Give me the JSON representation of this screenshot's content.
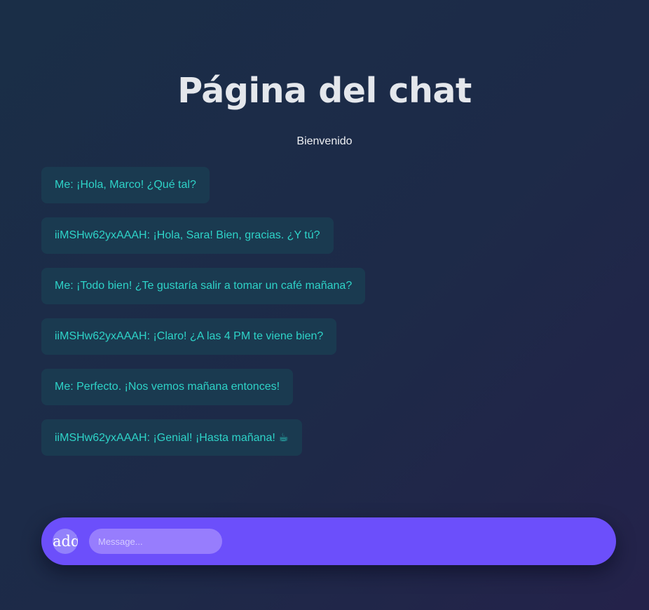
{
  "header": {
    "title": "Página del chat",
    "subtitle": "Bienvenido"
  },
  "messages": [
    {
      "text": "Me: ¡Hola, Marco! ¿Qué tal?"
    },
    {
      "text": "iiMSHw62yxAAAH: ¡Hola, Sara! Bien, gracias. ¿Y tú?"
    },
    {
      "text": "Me: ¡Todo bien! ¿Te gustaría salir a tomar un café mañana?"
    },
    {
      "text": "iiMSHw62yxAAAH: ¡Claro! ¿A las 4 PM te viene bien?"
    },
    {
      "text": "Me: Perfecto. ¡Nos vemos mañana entonces!"
    },
    {
      "text": "iiMSHw62yxAAAH: ¡Genial! ¡Hasta mañana! ☕"
    }
  ],
  "composer": {
    "add_label": "add",
    "placeholder": "Message..."
  },
  "colors": {
    "accent": "#6c4ffb",
    "bubble_bg": "#1a3a50",
    "bubble_text": "#2ed3c8"
  }
}
